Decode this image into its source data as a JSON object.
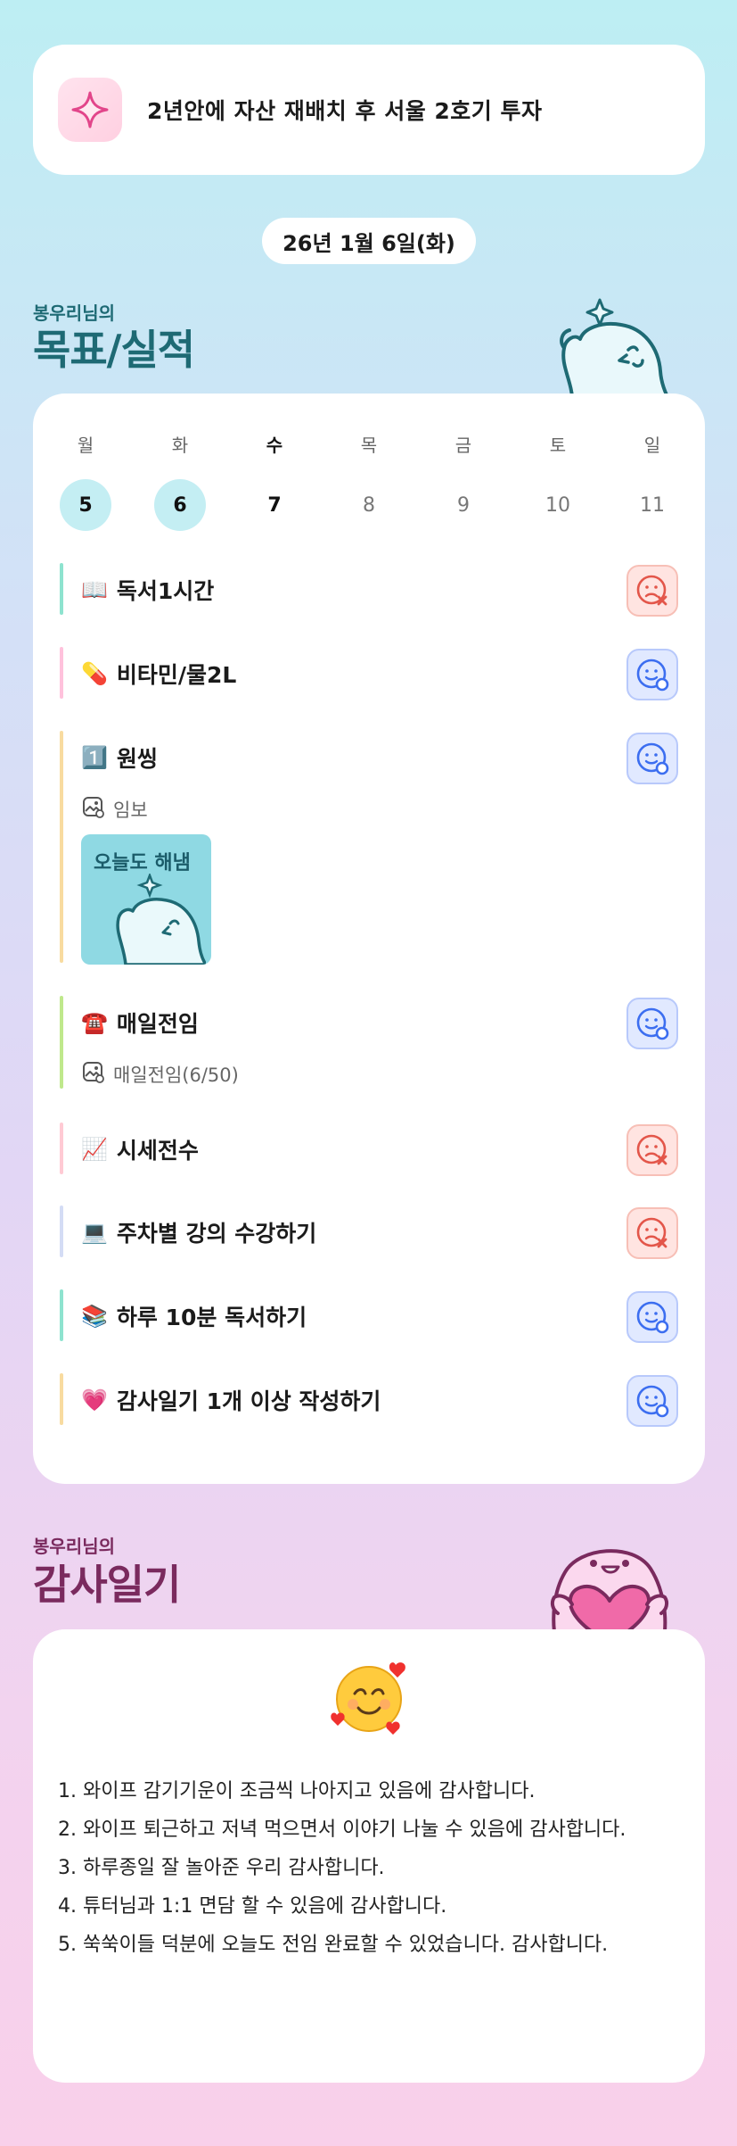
{
  "goal": {
    "text": "2년안에 자산 재배치 후 서울 2호기 투자",
    "icon": "sparkle-icon"
  },
  "date": "26년 1월 6일(화)",
  "goals_section": {
    "owner": "봉우리님의",
    "title": "목표/실적"
  },
  "week": {
    "days": [
      {
        "name": "월",
        "num": "5",
        "state": "done"
      },
      {
        "name": "화",
        "num": "6",
        "state": "done"
      },
      {
        "name": "수",
        "num": "7",
        "state": "today"
      },
      {
        "name": "목",
        "num": "8",
        "state": "none"
      },
      {
        "name": "금",
        "num": "9",
        "state": "none"
      },
      {
        "name": "토",
        "num": "10",
        "state": "none"
      },
      {
        "name": "일",
        "num": "11",
        "state": "none"
      }
    ]
  },
  "tasks": [
    {
      "emoji": "📖",
      "label": "독서1시간",
      "status": "fail",
      "bar": "#8ee3cf"
    },
    {
      "emoji": "💊",
      "label": "비타민/물2L",
      "status": "ok",
      "bar": "#ffc2dc"
    },
    {
      "emoji": "1️⃣",
      "label": "원씽",
      "status": "ok",
      "bar": "#f8dba0",
      "sub": "임보",
      "thumb_text": "오늘도 해냄"
    },
    {
      "emoji": "☎️",
      "label": "매일전임",
      "status": "ok",
      "bar": "#bfe88c",
      "sub": "매일전임(6/50)"
    },
    {
      "emoji": "📈",
      "label": "시세전수",
      "status": "fail",
      "bar": "#ffcad4"
    },
    {
      "emoji": "💻",
      "label": "주차별 강의 수강하기",
      "status": "fail",
      "bar": "#d4dcf5"
    },
    {
      "emoji": "📚",
      "label": "하루 10분 독서하기",
      "status": "ok",
      "bar": "#8ee3cf"
    },
    {
      "emoji": "💗",
      "label": "감사일기 1개 이상 작성하기",
      "status": "ok",
      "bar": "#f8dba0"
    }
  ],
  "gratitude_section": {
    "owner": "봉우리님의",
    "title": "감사일기",
    "emoji": "🥰"
  },
  "gratitude": [
    "1. 와이프 감기기운이 조금씩 나아지고 있음에 감사합니다.",
    "2. 와이프 퇴근하고 저녁 먹으면서 이야기 나눌 수 있음에 감사합니다.",
    "3. 하루종일 잘 놀아준 우리 감사합니다.",
    "4. 튜터님과 1:1 면담 할 수 있음에 감사합니다.",
    "5. 쑥쑥이들 덕분에 오늘도 전임 완료할 수 있었습니다. 감사합니다."
  ],
  "colors": {
    "ok": "#3c6ef0",
    "fail": "#e3564a",
    "title_teal": "#1e6a74",
    "title_plum": "#7a2a5e"
  }
}
